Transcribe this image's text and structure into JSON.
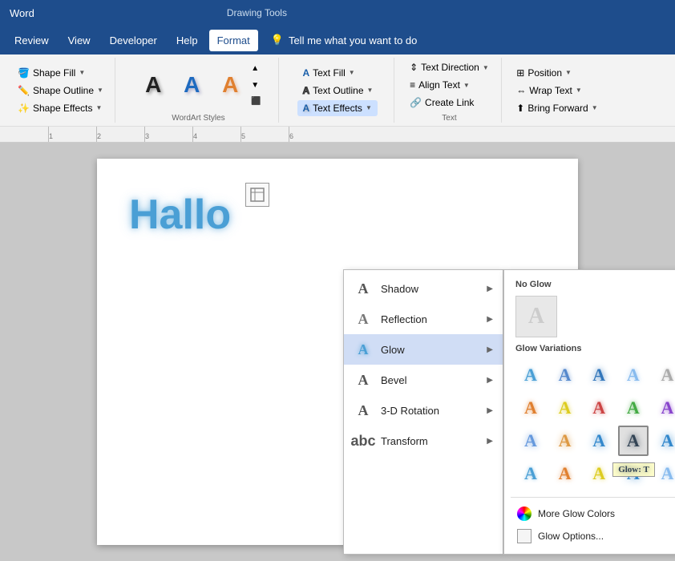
{
  "titleBar": {
    "appName": "Word",
    "section": "Drawing Tools"
  },
  "menuBar": {
    "items": [
      "Review",
      "View",
      "Developer",
      "Help",
      "Format"
    ],
    "activeItem": "Format",
    "tellMe": "Tell me what you want to do"
  },
  "ribbon": {
    "shapeGroup": {
      "label": "",
      "buttons": [
        {
          "label": "Shape Fill",
          "hasArrow": true
        },
        {
          "label": "Shape Outline",
          "hasArrow": true
        },
        {
          "label": "Shape Effects",
          "hasArrow": true
        }
      ]
    },
    "wordartGroup": {
      "label": "WordArt Styles",
      "previews": [
        "A",
        "A",
        "A"
      ]
    },
    "textEffectsGroup": {
      "label": "",
      "buttons": [
        {
          "label": "Text Fill",
          "hasArrow": true
        },
        {
          "label": "Text Outline",
          "hasArrow": true
        },
        {
          "label": "Text Effects",
          "hasArrow": true,
          "active": true
        }
      ]
    },
    "textGroup": {
      "label": "Text",
      "buttons": [
        {
          "label": "Text Direction",
          "hasArrow": true
        },
        {
          "label": "Align Text",
          "hasArrow": true
        },
        {
          "label": "Create Link"
        }
      ]
    },
    "arrangeGroup": {
      "label": "",
      "buttons": [
        {
          "label": "Position",
          "hasArrow": true
        },
        {
          "label": "Wrap Text",
          "hasArrow": true
        },
        {
          "label": "Bring Forward",
          "hasArrow": true
        }
      ]
    }
  },
  "textEffectsMenu": {
    "items": [
      {
        "id": "shadow",
        "label": "Shadow",
        "hasSubmenu": true
      },
      {
        "id": "reflection",
        "label": "Reflection",
        "hasSubmenu": true
      },
      {
        "id": "glow",
        "label": "Glow",
        "hasSubmenu": true,
        "active": true
      },
      {
        "id": "bevel",
        "label": "Bevel",
        "hasSubmenu": true
      },
      {
        "id": "3d-rotation",
        "label": "3-D Rotation",
        "hasSubmenu": true
      },
      {
        "id": "transform",
        "label": "Transform",
        "hasSubmenu": true
      }
    ]
  },
  "glowSubmenu": {
    "noGlowLabel": "No Glow",
    "variationsLabel": "Glow Variations",
    "rows": [
      [
        "g-blue1",
        "g-blue2",
        "g-blue3",
        "g-lblue",
        "g-gray"
      ],
      [
        "g-orange",
        "g-yellow",
        "g-red",
        "g-green",
        "g-purple"
      ],
      [
        "g-lblue2",
        "g-orange2",
        "g-more",
        "g-dark",
        "g-more"
      ],
      [
        "g-blue1",
        "g-orange",
        "g-yellow",
        "g-more",
        "g-lblue"
      ]
    ],
    "footerItems": [
      {
        "id": "more-colors",
        "label": "More Glow Colors"
      },
      {
        "id": "glow-options",
        "label": "Glow Options..."
      }
    ],
    "tooltip": "Glow: T"
  },
  "document": {
    "content": "Hallo"
  },
  "ruler": {
    "ticks": [
      "1",
      "2",
      "3",
      "4",
      "5",
      "6"
    ]
  }
}
